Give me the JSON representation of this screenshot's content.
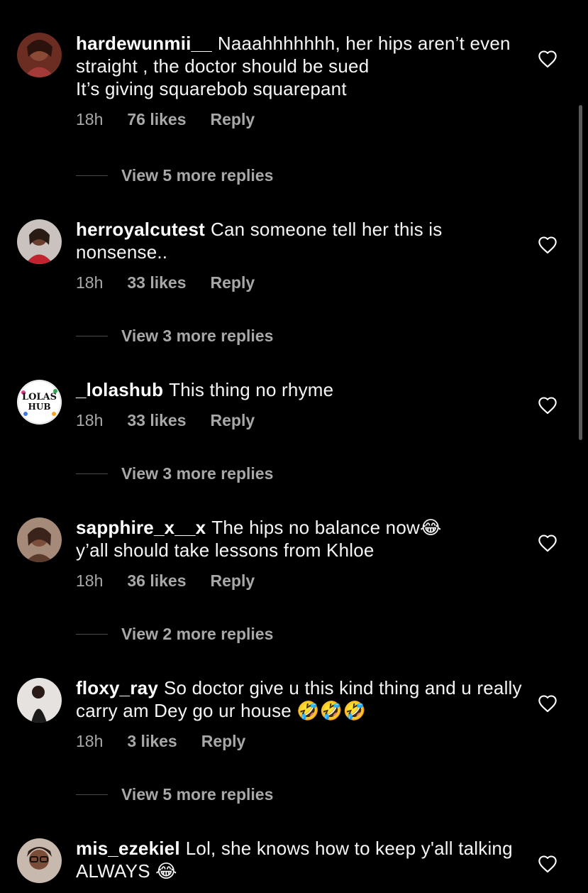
{
  "comments": [
    {
      "username": "hardewunmii__",
      "text": "Naaahhhhhhh, her hips aren’t even straight , the doctor should be sued\n  It’s giving squarebob squarepant",
      "time": "18h",
      "likes": "76 likes",
      "reply": "Reply",
      "view_replies": "View 5 more replies",
      "emojis": ""
    },
    {
      "username": "herroyalcutest",
      "text": "Can someone tell her this is nonsense..",
      "time": "18h",
      "likes": "33 likes",
      "reply": "Reply",
      "view_replies": "View 3 more replies",
      "emojis": ""
    },
    {
      "username": "_lolashub",
      "text": "This thing no rhyme",
      "time": "18h",
      "likes": "33 likes",
      "reply": "Reply",
      "view_replies": "View 3 more replies",
      "emojis": ""
    },
    {
      "username": "sapphire_x__x",
      "text": "The hips no balance now😂\ny’all should take lessons from Khloe",
      "time": "18h",
      "likes": "36 likes",
      "reply": "Reply",
      "view_replies": "View 2 more replies",
      "emojis": ""
    },
    {
      "username": "floxy_ray",
      "text": "So doctor give u this kind thing and u really carry am Dey go ur house 🤣🤣🤣",
      "time": "18h",
      "likes": "3 likes",
      "reply": "Reply",
      "view_replies": "View 5 more replies",
      "emojis": ""
    },
    {
      "username": "mis_ezekiel",
      "text": "Lol, she knows how to keep y'all talking ALWAYS 😂",
      "time": "",
      "likes": "",
      "reply": "",
      "view_replies": "",
      "emojis": ""
    }
  ],
  "colors": {
    "background": "#000000",
    "text": "#f5f5f5",
    "meta": "#a8a8a8",
    "divider": "#4a4a4a"
  },
  "icons": {
    "heart": "heart-outline-icon",
    "avatar": "avatar"
  }
}
